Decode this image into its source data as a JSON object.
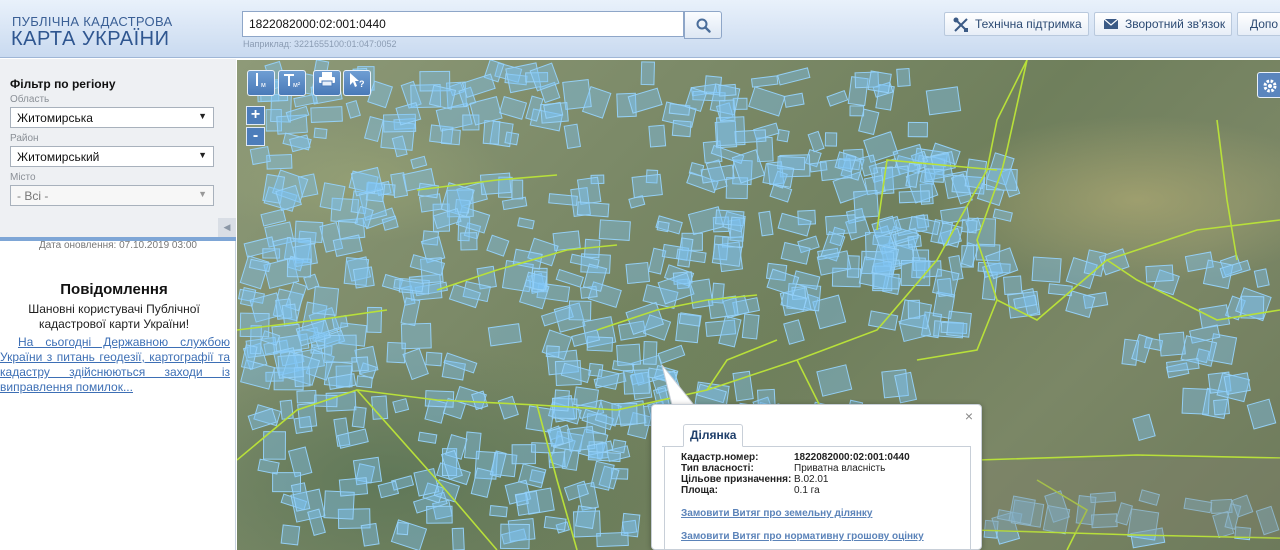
{
  "header": {
    "logo_line1": "ПУБЛІЧНА КАДАСТРОВА",
    "logo_line2": "КАРТА УКРАЇНИ",
    "search_value": "1822082000:02:001:0440",
    "search_example": "Наприклад: 3221655100:01:047:0052",
    "buttons": {
      "support": "Технічна підтримка",
      "feedback": "Зворотний зв'язок",
      "more": "Допо"
    }
  },
  "sidebar": {
    "filter_title": "Фільтр по регіону",
    "oblast_label": "Область",
    "oblast_value": "Житомирська",
    "rayon_label": "Район",
    "rayon_value": "Житомирський",
    "misto_label": "Місто",
    "misto_value": "- Всі -",
    "update_date": "Дата оновлення: 07.10.2019 03:00",
    "message_title": "Повідомлення",
    "message_text": "Шановні користувачі Публічної кадастрової карти України!",
    "message_link": "На сьогодні Державною службою України з питань геодезії, картографії та кадастру здійснюються заходи із виправлення помилок..."
  },
  "map_tools": {
    "ruler_icon": "ruler-icon",
    "area_icon": "area-measure-icon",
    "print_icon": "print-icon",
    "info_icon": "pointer-info-icon",
    "zoom_in": "+",
    "zoom_out": "-"
  },
  "popup": {
    "tab_label": "Ділянка",
    "close": "×",
    "fields": [
      {
        "key": "Кадастр.номер:",
        "value": "1822082000:02:001:0440"
      },
      {
        "key": "Тип власності:",
        "value": "Приватна власність"
      },
      {
        "key": "Цільове призначення:",
        "value": "В.02.01"
      },
      {
        "key": "Площа:",
        "value": "0.1 га"
      }
    ],
    "link1": "Замовити Витяг про земельну ділянку",
    "link2": "Замовити Витяг про нормативну грошову оцінку"
  },
  "colors": {
    "header_bg": "#c9daf0",
    "brand_text": "#2f5690",
    "parcel_fill": "#7fc4f4",
    "boundary_line": "#b8e03a",
    "tool_button": "#4a7ab8"
  }
}
